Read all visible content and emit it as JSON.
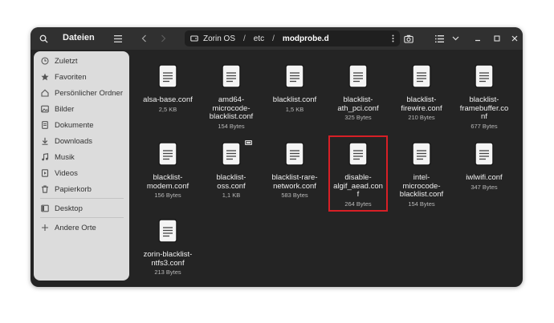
{
  "sidebar": {
    "title": "Dateien",
    "items": [
      {
        "label": "Zuletzt",
        "icon": "clock-icon"
      },
      {
        "label": "Favoriten",
        "icon": "star-icon"
      },
      {
        "label": "Persönlicher Ordner",
        "icon": "home-icon"
      },
      {
        "label": "Bilder",
        "icon": "image-icon"
      },
      {
        "label": "Dokumente",
        "icon": "document-icon"
      },
      {
        "label": "Downloads",
        "icon": "download-icon"
      },
      {
        "label": "Musik",
        "icon": "music-icon"
      },
      {
        "label": "Videos",
        "icon": "video-icon"
      },
      {
        "label": "Papierkorb",
        "icon": "trash-icon"
      },
      {
        "label": "Desktop",
        "icon": "desktop-icon"
      },
      {
        "label": "Andere Orte",
        "icon": "plus-icon"
      }
    ]
  },
  "path": {
    "root": "Zorin OS",
    "segments": [
      "etc",
      "modprobe.d"
    ],
    "separator": "/"
  },
  "files": [
    {
      "name": "alsa-base.conf",
      "size": "2,5 KB"
    },
    {
      "name": "amd64-microcode-blacklist.conf",
      "size": "154 Bytes"
    },
    {
      "name": "blacklist.conf",
      "size": "1,5 KB"
    },
    {
      "name": "blacklist-ath_pci.conf",
      "size": "325 Bytes"
    },
    {
      "name": "blacklist-firewire.conf",
      "size": "210 Bytes"
    },
    {
      "name": "blacklist-framebuffer.conf",
      "size": "677 Bytes"
    },
    {
      "name": "blacklist-modem.conf",
      "size": "156 Bytes"
    },
    {
      "name": "blacklist-oss.conf",
      "size": "1,1 KB"
    },
    {
      "name": "blacklist-rare-network.conf",
      "size": "583 Bytes"
    },
    {
      "name": "disable-algif_aead.conf",
      "size": "264 Bytes"
    },
    {
      "name": "intel-microcode-blacklist.conf",
      "size": "154 Bytes"
    },
    {
      "name": "iwlwifi.conf",
      "size": "347 Bytes"
    },
    {
      "name": "zorin-blacklist-ntfs3.conf",
      "size": "213 Bytes"
    }
  ],
  "colors": {
    "window_bg": "#242424",
    "header_bg": "#303030",
    "sidebar_bg": "#dcdcdc",
    "highlight": "#d71f26"
  }
}
